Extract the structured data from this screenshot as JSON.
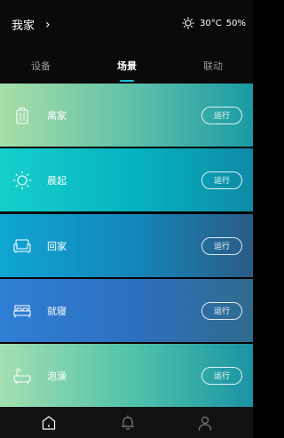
{
  "header": {
    "home_name": "我家",
    "chevron": "›",
    "weather_icon": "sun-icon",
    "temperature": "30°C",
    "humidity": "50%"
  },
  "tabs": [
    {
      "label": "设备",
      "active": false
    },
    {
      "label": "场景",
      "active": true
    },
    {
      "label": "联动",
      "active": false
    }
  ],
  "scenes": [
    {
      "label": "离家",
      "button": "运行",
      "icon": "luggage-icon"
    },
    {
      "label": "晨起",
      "button": "运行",
      "icon": "sun-icon"
    },
    {
      "label": "回家",
      "button": "运行",
      "icon": "sofa-icon"
    },
    {
      "label": "就寝",
      "button": "运行",
      "icon": "bed-icon"
    },
    {
      "label": "泡澡",
      "button": "运行",
      "icon": "bathtub-icon"
    }
  ],
  "bottom_nav": [
    {
      "icon": "home-icon",
      "active": true
    },
    {
      "icon": "bell-icon",
      "active": false
    },
    {
      "icon": "user-icon",
      "active": false
    }
  ],
  "colors": {
    "accent": "#18c3d5",
    "background": "#0a0a0a"
  }
}
